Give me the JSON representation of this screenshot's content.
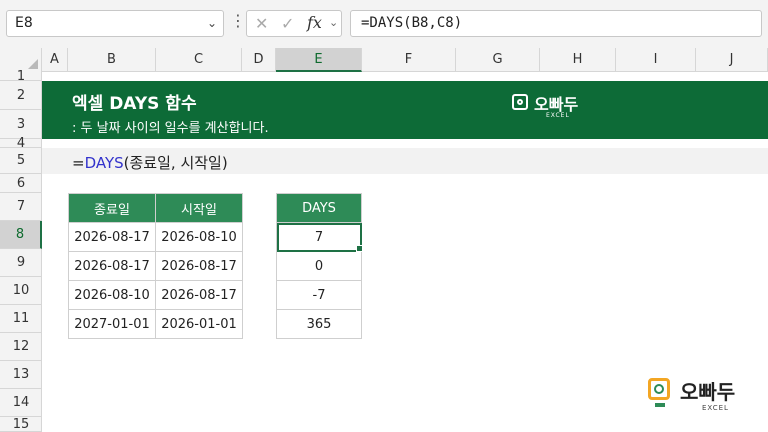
{
  "formula_bar": {
    "name_box": "E8",
    "fx_label": "fx",
    "formula": "=DAYS(B8,C8)"
  },
  "columns": [
    "A",
    "B",
    "C",
    "D",
    "E",
    "F",
    "G",
    "H",
    "I",
    "J"
  ],
  "rows": [
    "1",
    "2",
    "3",
    "4",
    "5",
    "6",
    "7",
    "8",
    "9",
    "10",
    "11",
    "12",
    "13",
    "14",
    "15"
  ],
  "banner": {
    "title": "엑셀 DAYS 함수",
    "subtitle": ": 두 날짜 사이의 일수를 계산합니다.",
    "logo_text": "오빠두",
    "logo_sub": "EXCEL"
  },
  "syntax": {
    "eq": "=",
    "fn": "DAYS",
    "args": "(종료일, 시작일)"
  },
  "table": {
    "headers": [
      "종료일",
      "시작일"
    ],
    "rows": [
      [
        "2026-08-17",
        "2026-08-10"
      ],
      [
        "2026-08-17",
        "2026-08-17"
      ],
      [
        "2026-08-10",
        "2026-08-17"
      ],
      [
        "2027-01-01",
        "2026-01-01"
      ]
    ]
  },
  "result": {
    "header": "DAYS",
    "values": [
      "7",
      "0",
      "-7",
      "365"
    ]
  },
  "corner_logo": {
    "text": "오빠두",
    "sub": "EXCEL"
  },
  "colors": {
    "banner": "#0d6b37",
    "table_header": "#2e8b57",
    "selection": "#1e7145"
  }
}
